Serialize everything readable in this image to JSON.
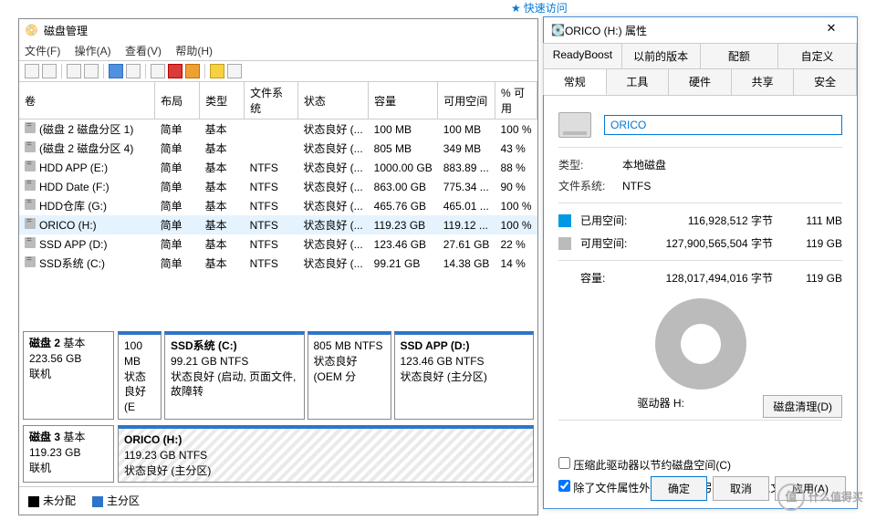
{
  "quickaccess": "快速访问",
  "dm": {
    "title": "磁盘管理",
    "menu": {
      "file": "文件(F)",
      "action": "操作(A)",
      "view": "查看(V)",
      "help": "帮助(H)"
    },
    "headers": {
      "vol": "卷",
      "layout": "布局",
      "type": "类型",
      "fs": "文件系统",
      "status": "状态",
      "capacity": "容量",
      "free": "可用空间",
      "pctfree": "% 可用"
    },
    "rows": [
      {
        "vol": "(磁盘 2 磁盘分区 1)",
        "layout": "简单",
        "type": "基本",
        "fs": "",
        "status": "状态良好 (...",
        "cap": "100 MB",
        "free": "100 MB",
        "pct": "100 %"
      },
      {
        "vol": "(磁盘 2 磁盘分区 4)",
        "layout": "简单",
        "type": "基本",
        "fs": "",
        "status": "状态良好 (...",
        "cap": "805 MB",
        "free": "349 MB",
        "pct": "43 %"
      },
      {
        "vol": "HDD APP (E:)",
        "layout": "简单",
        "type": "基本",
        "fs": "NTFS",
        "status": "状态良好 (...",
        "cap": "1000.00 GB",
        "free": "883.89 ...",
        "pct": "88 %"
      },
      {
        "vol": "HDD Date (F:)",
        "layout": "简单",
        "type": "基本",
        "fs": "NTFS",
        "status": "状态良好 (...",
        "cap": "863.00 GB",
        "free": "775.34 ...",
        "pct": "90 %"
      },
      {
        "vol": "HDD仓库 (G:)",
        "layout": "简单",
        "type": "基本",
        "fs": "NTFS",
        "status": "状态良好 (...",
        "cap": "465.76 GB",
        "free": "465.01 ...",
        "pct": "100 %"
      },
      {
        "vol": "ORICO (H:)",
        "layout": "简单",
        "type": "基本",
        "fs": "NTFS",
        "status": "状态良好 (...",
        "cap": "119.23 GB",
        "free": "119.12 ...",
        "pct": "100 %",
        "sel": true
      },
      {
        "vol": "SSD APP (D:)",
        "layout": "简单",
        "type": "基本",
        "fs": "NTFS",
        "status": "状态良好 (...",
        "cap": "123.46 GB",
        "free": "27.61 GB",
        "pct": "22 %"
      },
      {
        "vol": "SSD系统 (C:)",
        "layout": "简单",
        "type": "基本",
        "fs": "NTFS",
        "status": "状态良好 (...",
        "cap": "99.21 GB",
        "free": "14.38 GB",
        "pct": "14 %"
      }
    ],
    "disk2": {
      "label_head": "磁盘 2",
      "label_type": "基本",
      "label_size": "223.56 GB",
      "label_status": "联机",
      "p1a": "100 MB",
      "p1b": "状态良好 (E",
      "p2a": "SSD系统  (C:)",
      "p2b": "99.21 GB NTFS",
      "p2c": "状态良好 (启动, 页面文件, 故障转",
      "p3a": "805 MB NTFS",
      "p3b": "状态良好 (OEM 分",
      "p4a": "SSD APP (D:)",
      "p4b": "123.46 GB NTFS",
      "p4c": "状态良好 (主分区)"
    },
    "disk3": {
      "label_head": "磁盘 3",
      "label_type": "基本",
      "label_size": "119.23 GB",
      "label_status": "联机",
      "p1a": "ORICO  (H:)",
      "p1b": "119.23 GB NTFS",
      "p1c": "状态良好 (主分区)"
    },
    "legend": {
      "unalloc": "未分配",
      "primary": "主分区"
    }
  },
  "prop": {
    "title": "ORICO (H:) 属性",
    "tabs1": {
      "readyboost": "ReadyBoost",
      "prev": "以前的版本",
      "quota": "配额",
      "custom": "自定义"
    },
    "tabs2": {
      "general": "常规",
      "tools": "工具",
      "hardware": "硬件",
      "sharing": "共享",
      "security": "安全"
    },
    "name_value": "ORICO",
    "type_label": "类型:",
    "type_value": "本地磁盘",
    "fs_label": "文件系统:",
    "fs_value": "NTFS",
    "used_label": "已用空间:",
    "used_bytes": "116,928,512 字节",
    "used_size": "111 MB",
    "free_label": "可用空间:",
    "free_bytes": "127,900,565,504 字节",
    "free_size": "119 GB",
    "cap_label": "容量:",
    "cap_bytes": "128,017,494,016 字节",
    "cap_size": "119 GB",
    "drive_label": "驱动器 H:",
    "cleanup": "磁盘清理(D)",
    "compress": "压缩此驱动器以节约磁盘空间(C)",
    "index": "除了文件属性外，还允许索引此驱动器上文件的内容(I)",
    "ok": "确定",
    "cancel": "取消",
    "apply": "应用(A)"
  },
  "watermark": "什么值得买"
}
